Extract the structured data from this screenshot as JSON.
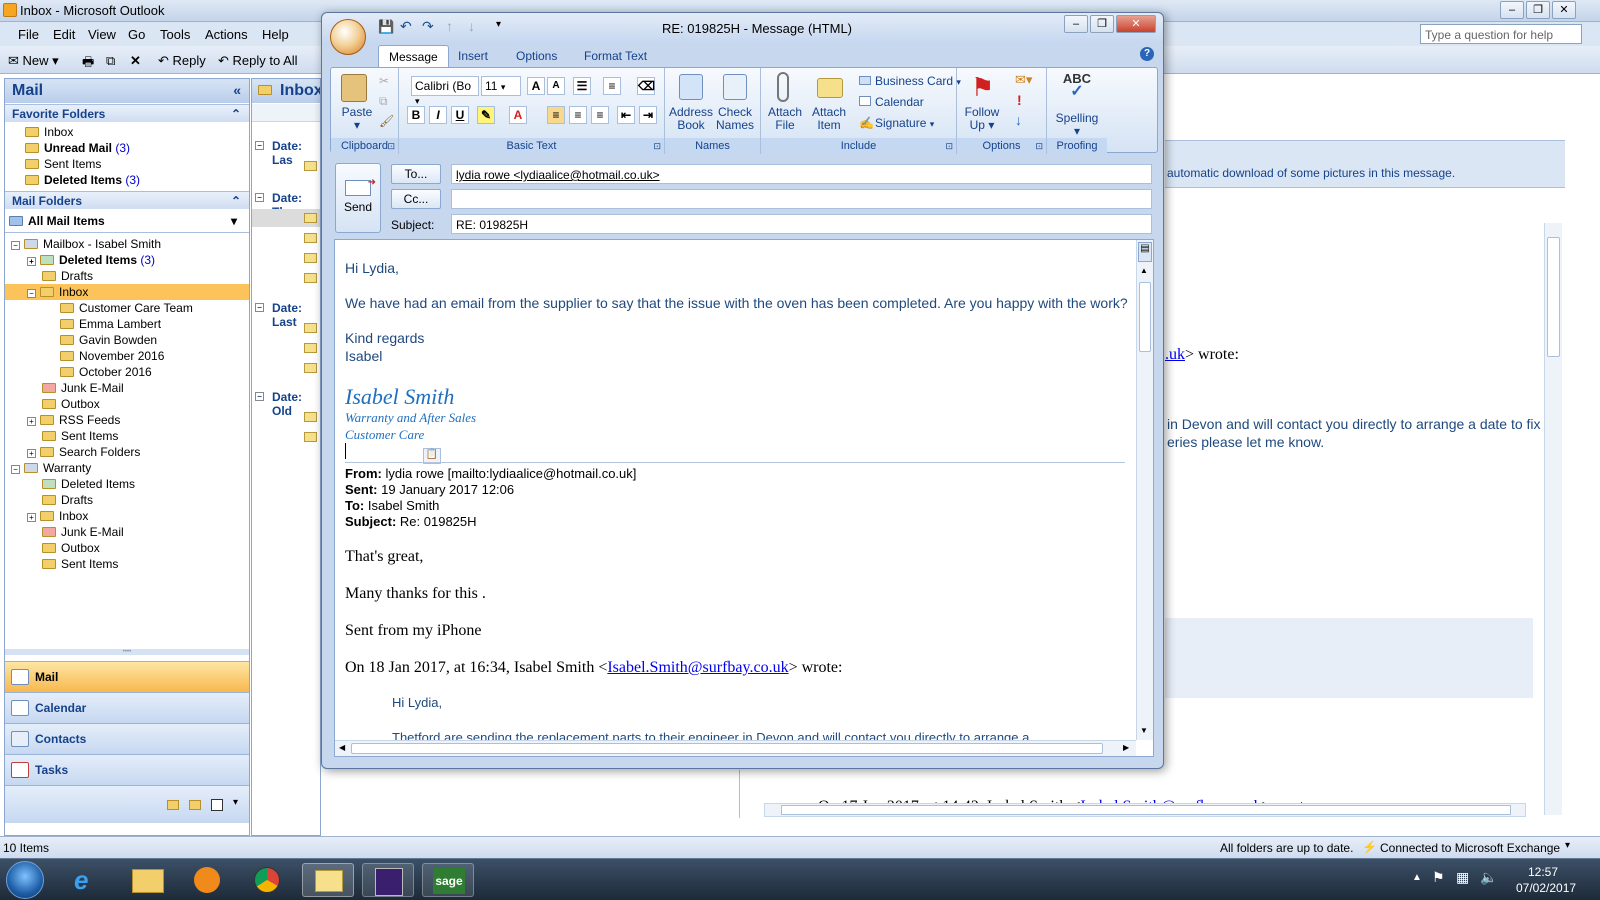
{
  "outlook": {
    "title": "Inbox - Microsoft Outlook",
    "menu": [
      "File",
      "Edit",
      "View",
      "Go",
      "Tools",
      "Actions",
      "Help"
    ],
    "help_placeholder": "Type a question for help",
    "toolbar": {
      "new": "New",
      "reply": "Reply",
      "reply_all": "Reply to All"
    },
    "nav_title": "Mail",
    "favorite_folders_label": "Favorite Folders",
    "favorites": [
      {
        "name": "Inbox",
        "count": ""
      },
      {
        "name": "Unread Mail",
        "count": "(3)"
      },
      {
        "name": "Sent Items",
        "count": ""
      },
      {
        "name": "Deleted Items",
        "count": "(3)"
      }
    ],
    "mail_folders_label": "Mail Folders",
    "all_mail_items": "All Mail Items",
    "tree": {
      "mailbox": "Mailbox - Isabel Smith",
      "deleted": "Deleted Items",
      "deleted_count": "(3)",
      "drafts": "Drafts",
      "inbox": "Inbox",
      "sub": [
        "Customer Care Team",
        "Emma Lambert",
        "Gavin Bowden",
        "November 2016",
        "October 2016"
      ],
      "junk": "Junk E-Mail",
      "outbox": "Outbox",
      "rss": "RSS Feeds",
      "sent": "Sent Items",
      "search": "Search Folders",
      "warranty": "Warranty",
      "w_items": [
        "Deleted Items",
        "Drafts",
        "Inbox",
        "Junk E-Mail",
        "Outbox",
        "Sent Items"
      ]
    },
    "nav_buttons": [
      "Mail",
      "Calendar",
      "Contacts",
      "Tasks"
    ],
    "list_title": "Inbox",
    "date_groups": [
      "Date: Las",
      "Date: Thre",
      "Date: Last",
      "Date: Old"
    ],
    "reading": {
      "info_bar": "automatic download of some pictures in this message.",
      "wrote1_link": ".uk",
      "wrote1": "> wrote:",
      "line1": "in Devon and will contact you directly to arrange a date to fix",
      "line2": "eries please let me know.",
      "bottom_pre": "On 17 Jan 2017, at 14:42, Isabel Smith <",
      "bottom_link": "Isabel.Smith@surfbay.co.uk",
      "bottom_post": "> wrote:"
    },
    "status": {
      "items": "10 Items",
      "sync": "All folders are up to date.",
      "connection": "Connected to Microsoft Exchange"
    },
    "clock": {
      "time": "12:57",
      "date": "07/02/2017"
    }
  },
  "message": {
    "title": "RE: 019825H - Message (HTML)",
    "tabs": [
      "Message",
      "Insert",
      "Options",
      "Format Text"
    ],
    "ribbon": {
      "paste": "Paste",
      "font": "Calibri (Bo",
      "size": "11",
      "groups": [
        "Clipboard",
        "Basic Text",
        "Names",
        "Include",
        "Options",
        "Proofing"
      ],
      "address_book": [
        "Address",
        "Book"
      ],
      "check_names": [
        "Check",
        "Names"
      ],
      "attach_file": [
        "Attach",
        "File"
      ],
      "attach_item": [
        "Attach",
        "Item"
      ],
      "business_card": "Business Card",
      "calendar": "Calendar",
      "signature": "Signature",
      "follow_up": [
        "Follow",
        "Up"
      ],
      "spelling": "Spelling",
      "abc": "ABC"
    },
    "send": "Send",
    "to_btn": "To...",
    "cc_btn": "Cc...",
    "subject_label": "Subject:",
    "to_value": "lydia rowe <lydiaalice@hotmail.co.uk>",
    "cc_value": "",
    "subject_value": "RE: 019825H",
    "body": {
      "greeting": "Hi Lydia,",
      "para": "We have had an email from the supplier to say that the issue with the oven has been completed. Are you happy with the work?",
      "regards": "Kind regards",
      "name": "Isabel",
      "sig_name": "Isabel Smith",
      "sig_line1": "Warranty and After Sales",
      "sig_line2": "Customer Care",
      "from_label": "From:",
      "from_value": "lydia rowe [mailto:lydiaalice@hotmail.co.uk]",
      "sent_label": "Sent:",
      "sent_value": "19 January 2017 12:06",
      "to_label": "To:",
      "to_value": "Isabel Smith",
      "subject_label": "Subject:",
      "subject_value": "Re: 019825H",
      "q1": "That's great,",
      "q2": "Many thanks for this .",
      "q3": "Sent from my iPhone",
      "q4_pre": "On 18 Jan 2017, at 16:34, Isabel Smith <",
      "q4_link": "Isabel.Smith@surfbay.co.uk",
      "q4_post": "> wrote:",
      "q5": "Hi Lydia,",
      "q6": "Thetford are sending the replacement parts to their engineer in Devon and will contact you directly to arrange a"
    }
  }
}
